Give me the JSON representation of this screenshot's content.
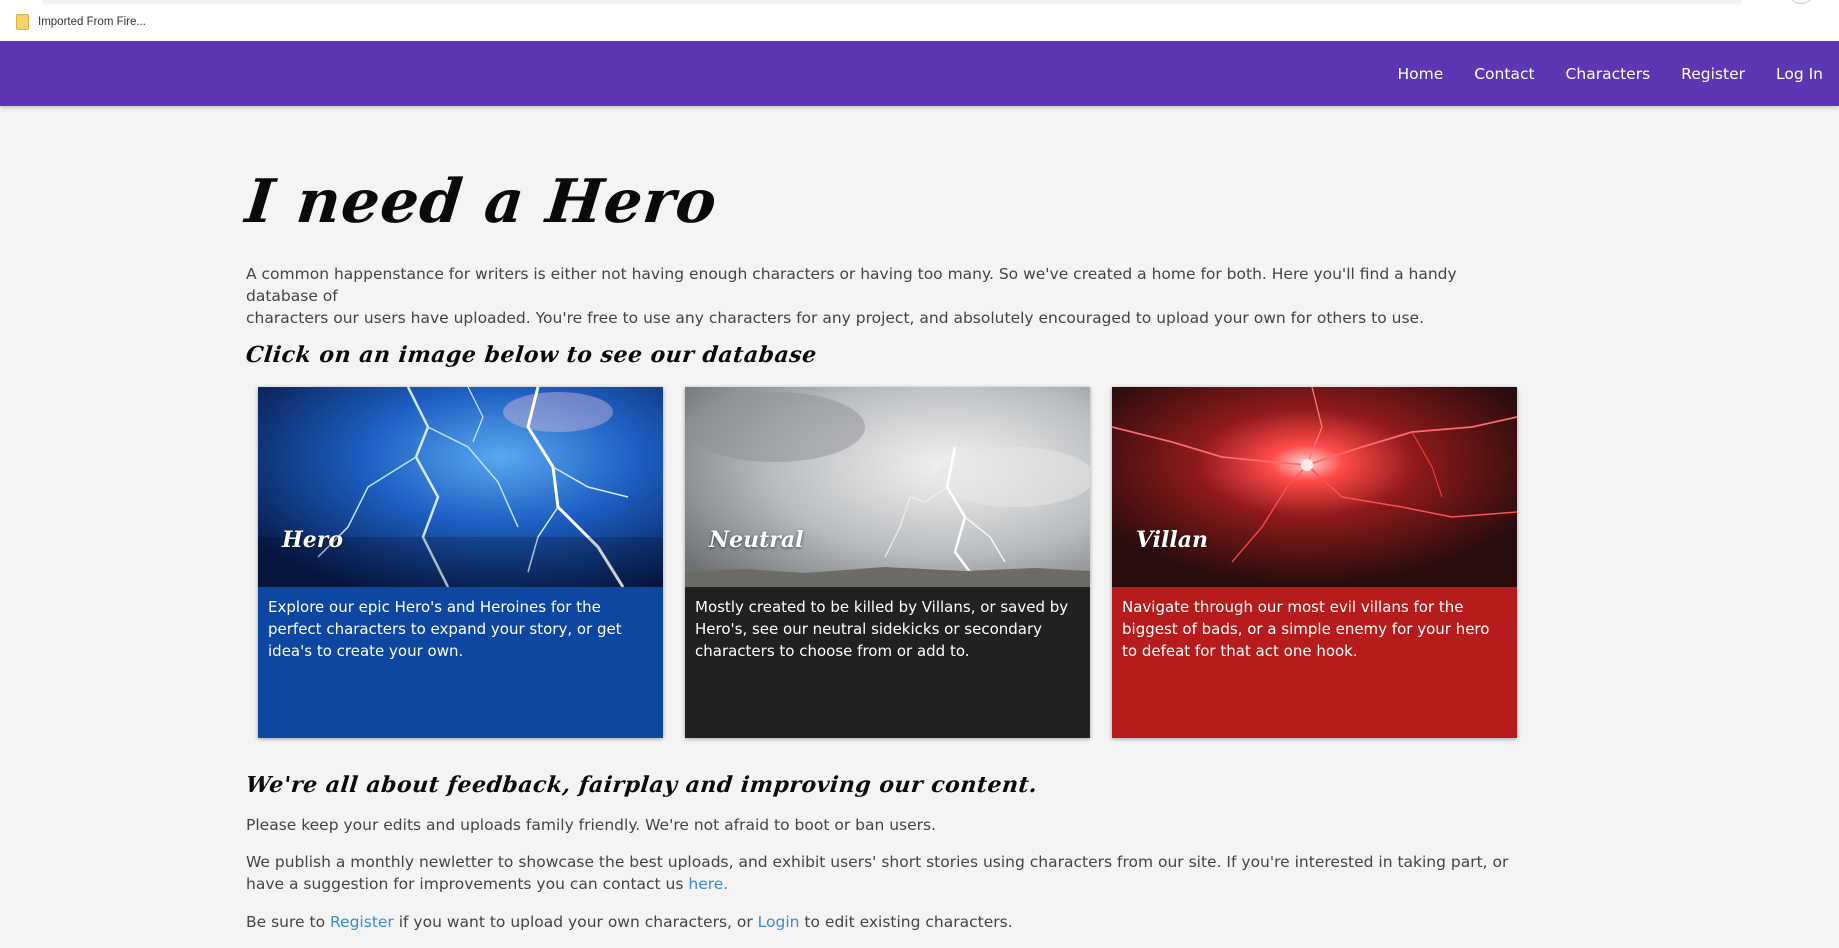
{
  "browser": {
    "bookmark_label": "Imported From Fire..."
  },
  "nav": {
    "links": [
      "Home",
      "Contact",
      "Characters",
      "Register",
      "Log In"
    ],
    "bg_color": "#5d37b3"
  },
  "main": {
    "title": "I need a Hero",
    "intro_line1": "A common happenstance for writers is either not having enough characters or having too many. So we've created a home for both. Here you'll find a handy database of",
    "intro_line2": "characters our users have uploaded. You're free to use any characters for any project, and absolutely encouraged to upload your own for others to use.",
    "click_heading": "Click on an image below to see our database",
    "cards": [
      {
        "label": "Hero",
        "description": "Explore our epic Hero's and Heroines for the perfect characters to expand your story, or get idea's to create your own.",
        "color": "#0d47a1"
      },
      {
        "label": "Neutral",
        "description": "Mostly created to be killed by Villans, or saved by Hero's, see our neutral sidekicks or secondary characters to choose from or add to.",
        "color": "#212121"
      },
      {
        "label": "Villan",
        "description": "Navigate through our most evil villans for the biggest of bads, or a simple enemy for your hero to defeat for that act one hook.",
        "color": "#b71c1c"
      }
    ],
    "feedback_heading": "We're all about feedback, fairplay and improving our content.",
    "para1": "Please keep your edits and uploads family friendly. We're not afraid to boot or ban users.",
    "para2_text": "We publish a monthly newletter to showcase the best uploads, and exhibit users' short stories using characters from our site. If you're interested in taking part, or have a suggestion for improvements you can contact us ",
    "para2_link": "here.",
    "para3_before": "Be sure to ",
    "para3_link1": "Register",
    "para3_middle": " if you want to upload your own characters, or ",
    "para3_link2": "Login",
    "para3_after": " to edit existing characters."
  }
}
